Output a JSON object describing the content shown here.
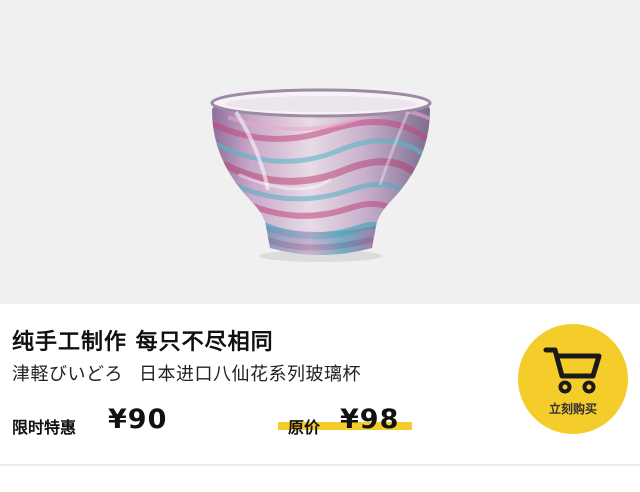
{
  "product": {
    "headline": "纯手工制作 每只不尽相同",
    "brand": "津軽びいどろ",
    "name": "日本进口八仙花系列玻璃杯"
  },
  "pricing": {
    "sale_label": "限时特惠",
    "sale_price": "¥90",
    "original_label": "原价",
    "original_price": "¥98"
  },
  "buy_button": {
    "label": "立刻购买",
    "icon": "shopping-cart-icon"
  },
  "colors": {
    "accent": "#f5cd2b",
    "image_background": "#f0f0f0"
  }
}
